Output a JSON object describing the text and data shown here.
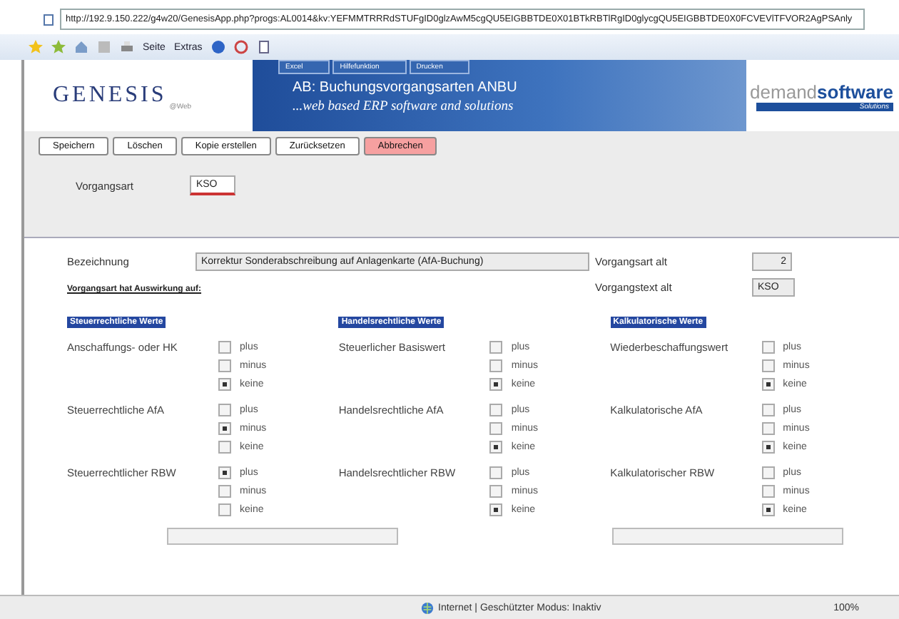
{
  "browser": {
    "address": "http://192.9.150.222/g4w20/GenesisApp.php?progs:AL0014&kv:YEFMMTRRRdSTUFgID0glzAwM5cgQU5EIGBBTDE0X01BTkRBTlRgID0glycgQU5EIGBBTDE0X0FCVEVlTFVOR2AgPSAnly",
    "toolbar": [
      "Seite",
      "Extras"
    ]
  },
  "header": {
    "logo": "GENESIS",
    "logo_sub": "@Web",
    "tabs": [
      "Excel",
      "Hilfefunktion",
      "Drucken"
    ],
    "title": "AB: Buchungsvorgangsarten ANBU",
    "slogan": "...web based ERP software and solutions",
    "brand_light": "demand",
    "brand_bold": "software",
    "brand_sub": "Solutions"
  },
  "buttons": [
    {
      "label": "Speichern",
      "kind": "normal"
    },
    {
      "label": "Löschen",
      "kind": "normal"
    },
    {
      "label": "Kopie erstellen",
      "kind": "normal"
    },
    {
      "label": "Zurücksetzen",
      "kind": "normal"
    },
    {
      "label": "Abbrechen",
      "kind": "cancel"
    }
  ],
  "key_field": {
    "label": "Vorgangsart",
    "value": "KSO"
  },
  "form": {
    "bezeichnung_label": "Bezeichnung",
    "bezeichnung": "Korrektur Sonderabschreibung auf Anlagenkarte (AfA-Buchung)",
    "alt_label": "Vorgangsart alt",
    "alt_value": "2",
    "text_alt_label": "Vorgangstext alt",
    "text_alt_value": "KSO",
    "effect_heading": "Vorgangsart hat Auswirkung auf:"
  },
  "sections": [
    {
      "title": "Steuerrechtliche Werte",
      "rows": [
        {
          "label": "Anschaffungs- oder HK",
          "options": [
            {
              "label": "plus",
              "selected": false
            },
            {
              "label": "minus",
              "selected": false
            },
            {
              "label": "keine",
              "selected": true
            }
          ]
        },
        {
          "label": "Steuerrechtliche AfA",
          "options": [
            {
              "label": "plus",
              "selected": false
            },
            {
              "label": "minus",
              "selected": true
            },
            {
              "label": "keine",
              "selected": false
            }
          ]
        },
        {
          "label": "Steuerrechtlicher RBW",
          "options": [
            {
              "label": "plus",
              "selected": true
            },
            {
              "label": "minus",
              "selected": false
            },
            {
              "label": "keine",
              "selected": false
            }
          ]
        }
      ]
    },
    {
      "title": "Handelsrechtliche Werte",
      "rows": [
        {
          "label": "Steuerlicher Basiswert",
          "options": [
            {
              "label": "plus",
              "selected": false
            },
            {
              "label": "minus",
              "selected": false
            },
            {
              "label": "keine",
              "selected": true
            }
          ]
        },
        {
          "label": "Handelsrechtliche AfA",
          "options": [
            {
              "label": "plus",
              "selected": false
            },
            {
              "label": "minus",
              "selected": false
            },
            {
              "label": "keine",
              "selected": true
            }
          ]
        },
        {
          "label": "Handelsrechtlicher RBW",
          "options": [
            {
              "label": "plus",
              "selected": false
            },
            {
              "label": "minus",
              "selected": false
            },
            {
              "label": "keine",
              "selected": true
            }
          ]
        }
      ]
    },
    {
      "title": "Kalkulatorische Werte",
      "rows": [
        {
          "label": "Wiederbeschaffungswert",
          "options": [
            {
              "label": "plus",
              "selected": false
            },
            {
              "label": "minus",
              "selected": false
            },
            {
              "label": "keine",
              "selected": true
            }
          ]
        },
        {
          "label": "Kalkulatorische AfA",
          "options": [
            {
              "label": "plus",
              "selected": false
            },
            {
              "label": "minus",
              "selected": false
            },
            {
              "label": "keine",
              "selected": true
            }
          ]
        },
        {
          "label": "Kalkulatorischer RBW",
          "options": [
            {
              "label": "plus",
              "selected": false
            },
            {
              "label": "minus",
              "selected": false
            },
            {
              "label": "keine",
              "selected": true
            }
          ]
        }
      ]
    }
  ],
  "status_bar": {
    "zone": "Internet | Geschützter Modus: Inaktiv",
    "zoom": "100%"
  }
}
